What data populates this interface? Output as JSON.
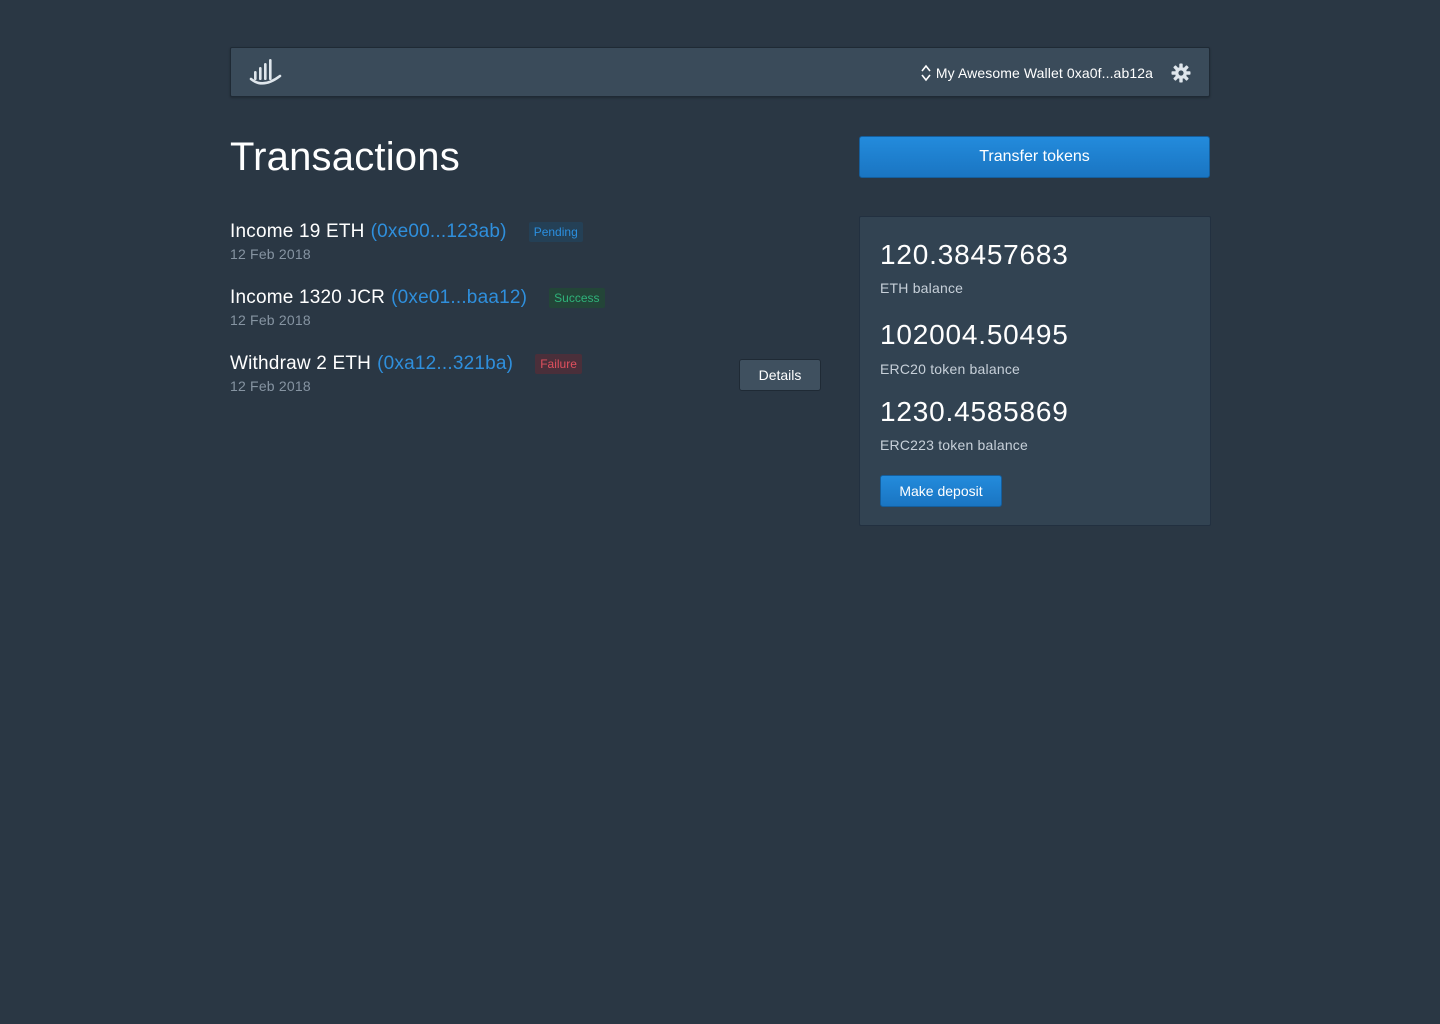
{
  "header": {
    "wallet_label": "My Awesome Wallet 0xa0f...ab12a"
  },
  "page_title": "Transactions",
  "transactions": [
    {
      "title": "Income 19 ETH",
      "hash": "(0xe00...123ab)",
      "status": "Pending",
      "date": "12 Feb 2018"
    },
    {
      "title": "Income 1320 JCR",
      "hash": "(0xe01...baa12)",
      "status": "Success",
      "date": "12 Feb 2018"
    },
    {
      "title": "Withdraw 2 ETH",
      "hash": "(0xa12...321ba)",
      "status": "Failure",
      "date": "12 Feb 2018"
    }
  ],
  "details_label": "Details",
  "transfer_label": "Transfer tokens",
  "balances": [
    {
      "value": "120.38457683",
      "label": "ETH balance"
    },
    {
      "value": "102004.50495",
      "label": "ERC20 token balance"
    },
    {
      "value": "1230.4585869",
      "label": "ERC223 token balance"
    }
  ],
  "deposit_label": "Make deposit",
  "colors": {
    "background": "#2a3744",
    "accent": "#2f8fdc",
    "pending": "#2b8fe0",
    "success": "#2fb37a",
    "failure": "#e0505e"
  },
  "icons": [
    "logo-icon",
    "sort-arrows-icon",
    "gear-icon"
  ]
}
